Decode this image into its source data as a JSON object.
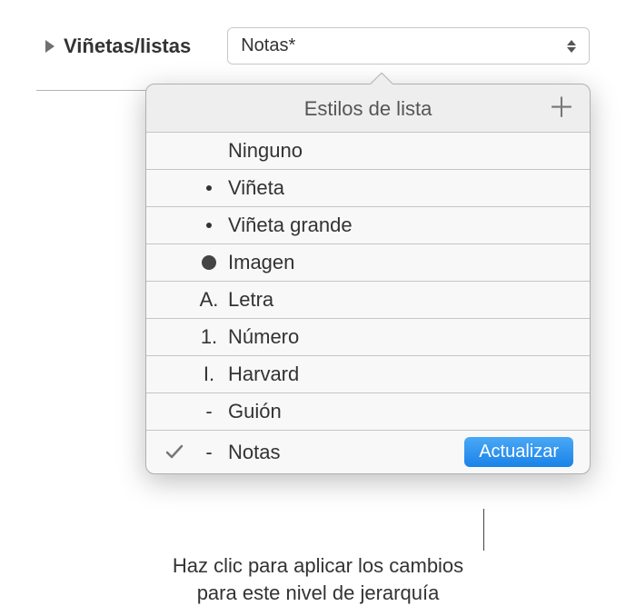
{
  "section": {
    "label": "Viñetas/listas"
  },
  "dropdown": {
    "value": "Notas*"
  },
  "popover": {
    "title": "Estilos de lista",
    "styles": [
      {
        "prefix": "",
        "name": "Ninguno",
        "bullet": "none"
      },
      {
        "prefix": "",
        "name": "Viñeta",
        "bullet": "small"
      },
      {
        "prefix": "",
        "name": "Viñeta grande",
        "bullet": "small"
      },
      {
        "prefix": "",
        "name": "Imagen",
        "bullet": "big"
      },
      {
        "prefix": "A.",
        "name": "Letra",
        "bullet": "text"
      },
      {
        "prefix": "1.",
        "name": "Número",
        "bullet": "text"
      },
      {
        "prefix": "I.",
        "name": "Harvard",
        "bullet": "text"
      },
      {
        "prefix": "-",
        "name": "Guión",
        "bullet": "text"
      },
      {
        "prefix": "-",
        "name": "Notas",
        "bullet": "text",
        "selected": true,
        "updatable": true
      }
    ],
    "update_button": "Actualizar"
  },
  "callout": {
    "line1": "Haz clic para aplicar los cambios",
    "line2": "para este nivel de jerarquía"
  }
}
